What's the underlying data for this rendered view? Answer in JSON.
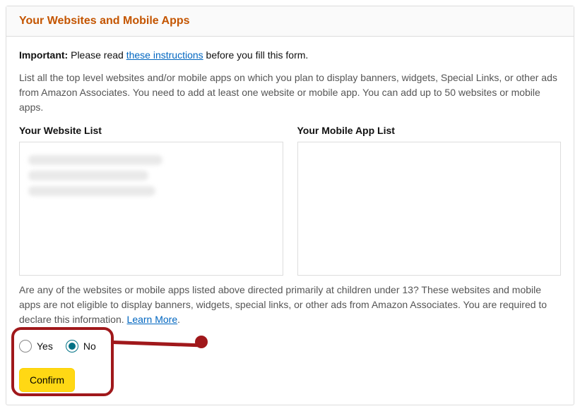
{
  "panel": {
    "title": "Your Websites and Mobile Apps"
  },
  "important": {
    "label": "Important:",
    "prefix": " Please read ",
    "link": "these instructions",
    "suffix": " before you fill this form."
  },
  "description": "List all the top level websites and/or mobile apps on which you plan to display banners, widgets, Special Links, or other ads from Amazon Associates. You need to add at least one website or mobile app. You can add up to 50 websites or mobile apps.",
  "columns": {
    "website_label": "Your Website List",
    "mobile_label": "Your Mobile App List"
  },
  "question": {
    "text": "Are any of the websites or mobile apps listed above directed primarily at children under 13? These websites and mobile apps are not eligible to display banners, widgets, special links, or other ads from Amazon Associates. You are required to declare this information. ",
    "learn_more": "Learn More",
    "period": "."
  },
  "radios": {
    "yes": "Yes",
    "no": "No",
    "selected": "no"
  },
  "confirm_label": "Confirm"
}
